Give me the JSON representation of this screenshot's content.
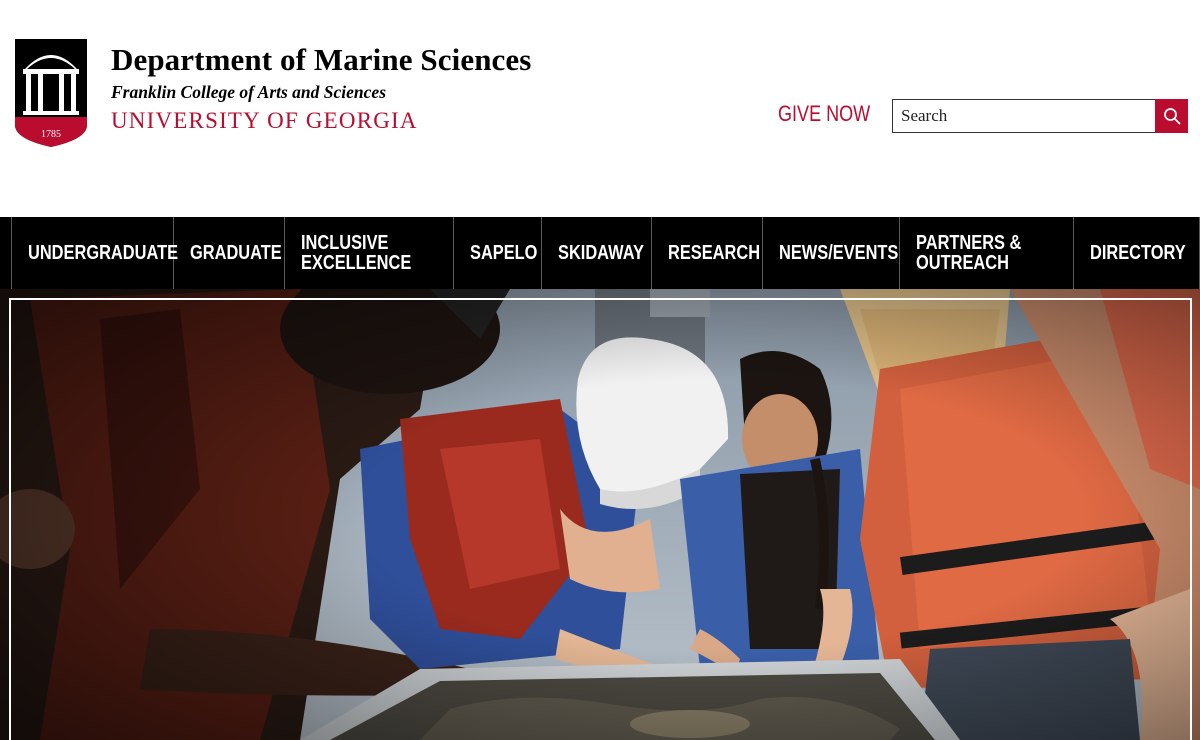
{
  "header": {
    "department": "Department of Marine Sciences",
    "college": "Franklin College of Arts and Sciences",
    "university": "UNIVERSITY OF GEORGIA",
    "logo_year": "1785",
    "give_now": "GIVE NOW",
    "search": {
      "placeholder": "Search"
    }
  },
  "nav": {
    "items": [
      {
        "label": "UNDERGRADUATE"
      },
      {
        "label": "GRADUATE"
      },
      {
        "label_line1": "INCLUSIVE",
        "label_line2": "EXCELLENCE"
      },
      {
        "label": "SAPELO"
      },
      {
        "label": "SKIDAWAY"
      },
      {
        "label": "RESEARCH"
      },
      {
        "label": "NEWS/EVENTS"
      },
      {
        "label_line1": "PARTNERS &",
        "label_line2": "OUTREACH"
      },
      {
        "label": "DIRECTORY"
      }
    ]
  },
  "colors": {
    "brand_red": "#ba0c2f",
    "nav_bg": "#000000"
  },
  "icons": {
    "search": "search-icon",
    "logo": "arch-logo-icon"
  }
}
